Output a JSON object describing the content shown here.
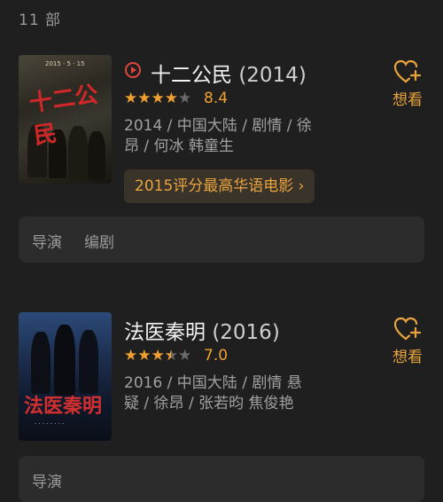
{
  "result_count": "11 部",
  "movies": [
    {
      "title": "十二公民",
      "year": "(2014)",
      "rating": "8.4",
      "stars": [
        1,
        1,
        1,
        1,
        0
      ],
      "meta_line1": "2014 / 中国大陆 / 剧情 / 徐",
      "meta_line2": "昂 / 何冰 韩童生",
      "award": "2015评分最高华语电影 ›",
      "poster_title": "十二公民",
      "fav_label": "想看",
      "crew_labels": [
        "导演",
        "编剧"
      ]
    },
    {
      "title": "法医秦明",
      "year": "(2016)",
      "rating": "7.0",
      "stars": [
        1,
        1,
        1,
        0.5,
        0
      ],
      "meta_line1": "2016 / 中国大陆 / 剧情 悬",
      "meta_line2": "疑 / 徐昂 / 张若昀 焦俊艳",
      "poster_title": "法医秦明",
      "fav_label": "想看",
      "crew_labels": [
        "导演"
      ]
    }
  ]
}
